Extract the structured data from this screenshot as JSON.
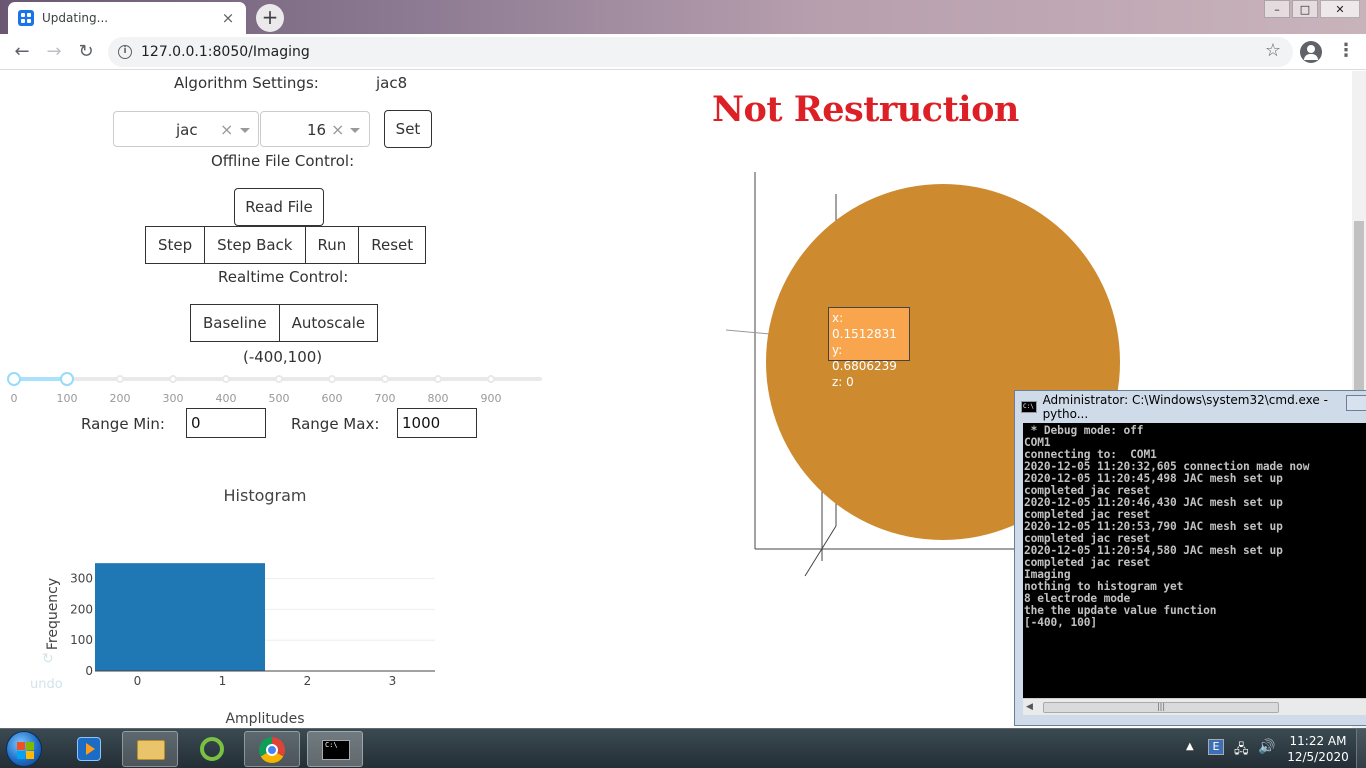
{
  "browser": {
    "tab_title": "Updating...",
    "tab_close": "×",
    "new_tab": "+",
    "url": "127.0.0.1:8050/Imaging",
    "window_controls": {
      "minimize": "–",
      "maximize": "□",
      "close": "✕"
    }
  },
  "settings": {
    "algorithm_label": "Algorithm Settings:",
    "algorithm_value": "jac8",
    "algorithm_select": "jac",
    "electrode_select": "16",
    "clear_symbol": "×",
    "set_button": "Set"
  },
  "offline": {
    "label": "Offline File Control:",
    "read_file_button": "Read File",
    "buttons": [
      "Step",
      "Step Back",
      "Run",
      "Reset"
    ]
  },
  "realtime": {
    "label": "Realtime Control:",
    "buttons": [
      "Baseline",
      "Autoscale"
    ],
    "range_display": "(-400,100)"
  },
  "slider": {
    "marks": [
      "0",
      "100",
      "200",
      "300",
      "400",
      "500",
      "600",
      "700",
      "800",
      "900"
    ],
    "min": 0,
    "max": 1000,
    "value": [
      0,
      100
    ]
  },
  "range": {
    "min_label": "Range Min:",
    "min_value": "0",
    "max_label": "Range Max:",
    "max_value": "1000"
  },
  "plot": {
    "undo_label": "undo",
    "undo_icon": "undo-icon"
  },
  "chart_data": {
    "type": "bar",
    "title": "Histogram",
    "xlabel": "Amplitudes",
    "ylabel": "Frequency",
    "x_ticks": [
      "0",
      "1",
      "2",
      "3"
    ],
    "y_ticks": [
      "0",
      "100",
      "200",
      "300"
    ],
    "bins": [
      {
        "x0": -0.5,
        "x1": 1.5,
        "value": 350
      }
    ],
    "xlim": [
      -0.5,
      3.5
    ],
    "ylim": [
      0,
      370
    ],
    "bar_color": "#1f77b4",
    "grid": true
  },
  "image_view": {
    "title": "Not Restruction",
    "title_color": "#dc2026",
    "disc_color": "#cd8a2f",
    "hover": {
      "x": "x: 0.1512831",
      "y": "y: 0.6806239",
      "z": "z: 0"
    }
  },
  "cmd": {
    "title": "Administrator: C:\\Windows\\system32\\cmd.exe - pytho...",
    "icon_text": "C:\\",
    "scroll_grip": "|||",
    "lines": [
      " * Debug mode: off",
      "COM1",
      "connecting to:  COM1",
      "2020-12-05 11:20:32,605 connection made now",
      "2020-12-05 11:20:45,498 JAC mesh set up",
      "completed jac reset",
      "2020-12-05 11:20:46,430 JAC mesh set up",
      "completed jac reset",
      "2020-12-05 11:20:53,790 JAC mesh set up",
      "completed jac reset",
      "2020-12-05 11:20:54,580 JAC mesh set up",
      "completed jac reset",
      "Imaging",
      "nothing to histogram yet",
      "8 electrode mode",
      "the the update value function",
      "[-400, 100]"
    ]
  },
  "taskbar": {
    "time": "11:22 AM",
    "date": "12/5/2020",
    "apps": [
      "media-player-icon",
      "file-explorer-icon",
      "greenshot-icon",
      "chrome-icon",
      "cmd-icon"
    ]
  }
}
